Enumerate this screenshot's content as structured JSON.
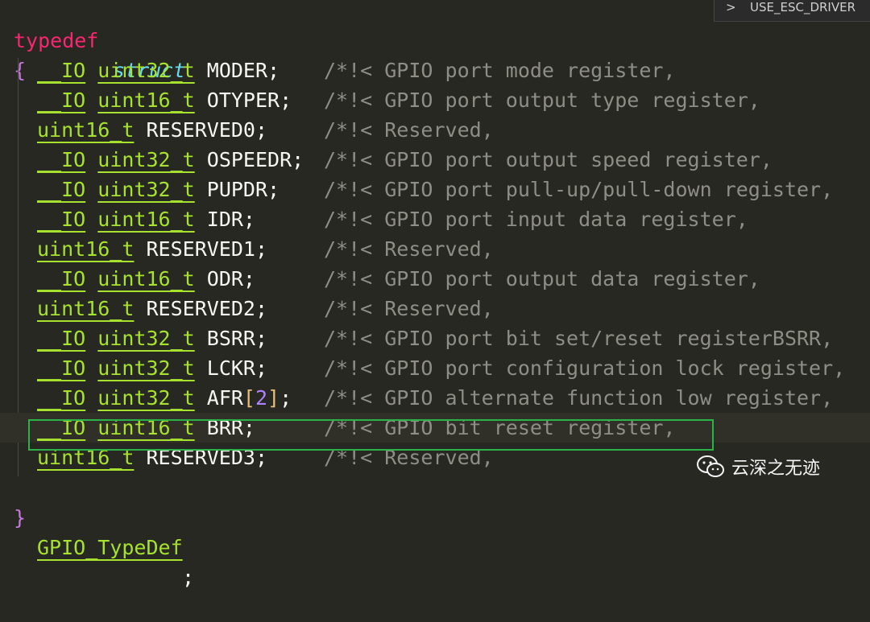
{
  "header": {
    "typedef_kw": "typedef",
    "struct_kw": "struct",
    "open_brace": "{"
  },
  "panel": {
    "chevron": ">",
    "text": "USE_ESC_DRIVER"
  },
  "lines": [
    {
      "qual": "__IO",
      "type": "uint32_t",
      "name": "MODER;",
      "comment": "/*!< GPIO port mode register,"
    },
    {
      "qual": "__IO",
      "type": "uint16_t",
      "name": "OTYPER;",
      "comment": "/*!< GPIO port output type register,"
    },
    {
      "qual": "",
      "type": "uint16_t",
      "name": "RESERVED0;",
      "comment": "/*!< Reserved,"
    },
    {
      "qual": "__IO",
      "type": "uint32_t",
      "name": "OSPEEDR;",
      "comment": "/*!< GPIO port output speed register,"
    },
    {
      "qual": "__IO",
      "type": "uint32_t",
      "name": "PUPDR;",
      "comment": "/*!< GPIO port pull-up/pull-down register,"
    },
    {
      "qual": "__IO",
      "type": "uint16_t",
      "name": "IDR;",
      "comment": "/*!< GPIO port input data register,"
    },
    {
      "qual": "",
      "type": "uint16_t",
      "name": "RESERVED1;",
      "comment": "/*!< Reserved,"
    },
    {
      "qual": "__IO",
      "type": "uint16_t",
      "name": "ODR;",
      "comment": "/*!< GPIO port output data register,"
    },
    {
      "qual": "",
      "type": "uint16_t",
      "name": "RESERVED2;",
      "comment": "/*!< Reserved,"
    },
    {
      "qual": "__IO",
      "type": "uint32_t",
      "name": "BSRR;",
      "comment": "/*!< GPIO port bit set/reset registerBSRR,"
    },
    {
      "qual": "__IO",
      "type": "uint32_t",
      "name": "LCKR;",
      "comment": "/*!< GPIO port configuration lock register,"
    },
    {
      "qual": "__IO",
      "type": "uint32_t",
      "name": "AFR",
      "index": "2",
      "name_end": ";",
      "comment": "/*!< GPIO alternate function low register,"
    },
    {
      "qual": "__IO",
      "type": "uint16_t",
      "name": "BRR;",
      "comment": "/*!< GPIO bit reset register,"
    },
    {
      "qual": "",
      "type": "uint16_t",
      "name": "RESERVED3;",
      "comment": "/*!< Reserved,"
    }
  ],
  "footer": {
    "close_brace": "}",
    "type_name": "GPIO_TypeDef",
    "semicolon": ";"
  },
  "watermark": {
    "text": "云深之无迹"
  },
  "colors": {
    "highlight_box": "#2bb34a",
    "background": "#272822"
  }
}
